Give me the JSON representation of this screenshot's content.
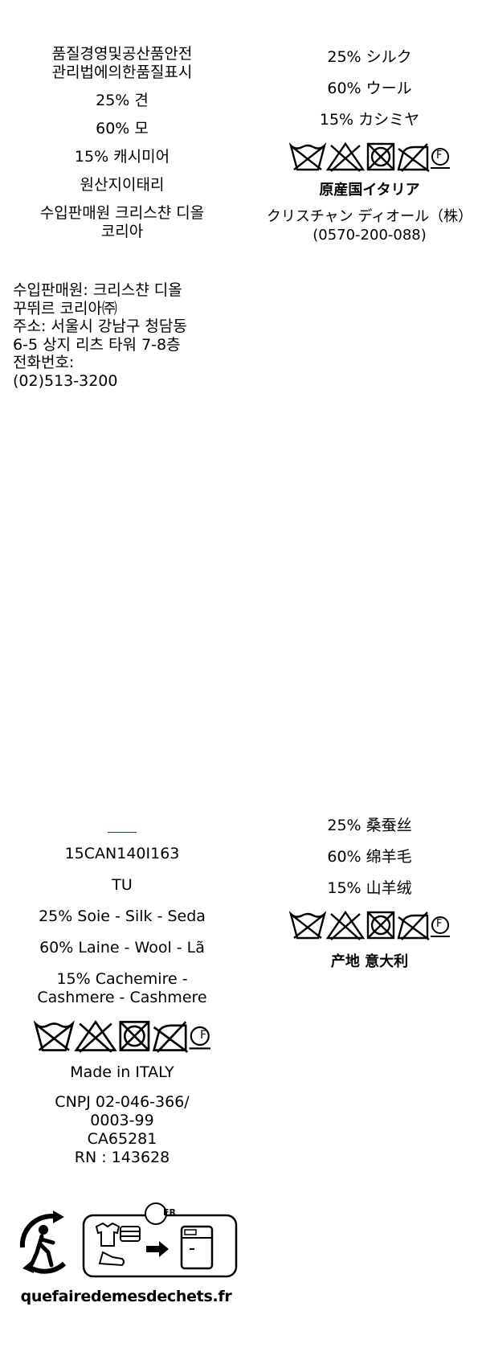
{
  "korean": {
    "title": [
      "품질경영및공산품안전",
      "관리법에의한품질표시"
    ],
    "silk": "25% 견",
    "wool": "60% 모",
    "cashmere": "15% 캐시미어",
    "origin": "원산지이태리",
    "importer": [
      "수입판매원 크리스챤 디올",
      "코리아"
    ],
    "details": [
      "수입판매원: 크리스챤 디올",
      "꾸뛰르 코리아㈜",
      "주소: 서울시 강남구 청담동",
      "6-5 상지 리츠 타워 7-8층",
      "전화번호:",
      "(02)513-3200"
    ]
  },
  "japanese": {
    "silk": "25% シルク",
    "wool": "60% ウール",
    "cashmere": "15% カシミヤ",
    "origin": "原産国イタリア",
    "company": "クリスチャン ディオール（株）",
    "phone": "(0570-200-088)"
  },
  "international": {
    "code": "15CAN140I163",
    "size": "TU",
    "silk": "25% Soie - Silk - Seda",
    "wool": "60% Laine - Wool - Lã",
    "cashmere": [
      "15% Cachemire -",
      "Cashmere - Cashmere"
    ],
    "origin": "Made in ITALY",
    "registry": [
      "CNPJ  02-046-366/",
      "0003-99",
      "CA65281",
      "RN : 143628"
    ],
    "recycle_badge": "FR",
    "recycle_site": "quefairedemesdechets.fr"
  },
  "chinese": {
    "silk": "25% 桑蚕丝",
    "wool": "60% 绵羊毛",
    "cashmere": "15% 山羊绒",
    "origin": "产地 意大利"
  },
  "care_symbols": {
    "icons": [
      "wash-30-icon",
      "no-bleach-icon",
      "no-tumble-dry-icon",
      "iron-low-icon",
      "dry-clean-f-icon"
    ],
    "dryclean_letter": "F"
  }
}
